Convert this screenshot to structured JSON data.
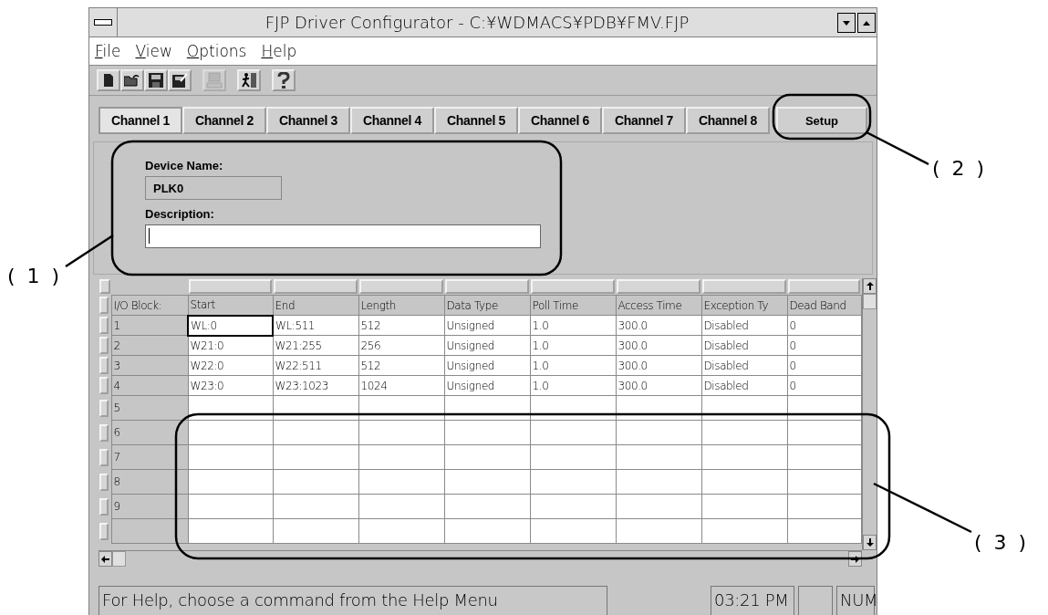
{
  "window": {
    "title": "FJP Driver Configurator - C:¥WDMACS¥PDB¥FMV.FJP"
  },
  "menu": [
    "File",
    "View",
    "Options",
    "Help"
  ],
  "toolbar": [
    {
      "kind": "new",
      "disabled": false
    },
    {
      "kind": "open",
      "disabled": false
    },
    {
      "kind": "save",
      "disabled": false
    },
    {
      "kind": "save-as",
      "disabled": false
    },
    {
      "kind": "computer",
      "disabled": true
    },
    {
      "kind": "exit",
      "disabled": false
    },
    {
      "kind": "help",
      "disabled": false
    }
  ],
  "tabs": [
    {
      "label": "Channel 1",
      "selected": true
    },
    {
      "label": "Channel 2",
      "selected": false
    },
    {
      "label": "Channel 3",
      "selected": false
    },
    {
      "label": "Channel 4",
      "selected": false
    },
    {
      "label": "Channel 5",
      "selected": false
    },
    {
      "label": "Channel 6",
      "selected": false
    },
    {
      "label": "Channel 7",
      "selected": false
    },
    {
      "label": "Channel 8",
      "selected": false
    }
  ],
  "setup_button": {
    "label": "Setup"
  },
  "device": {
    "name_label": "Device Name:",
    "name": "PLK0",
    "description_label": "Description:"
  },
  "grid": {
    "columns": [
      "I/O Block:",
      "Start",
      "End",
      "Length",
      "Data Type",
      "Poll Time",
      "Access Time",
      "Exception Ty",
      "Dead Band"
    ],
    "rows": [
      {
        "cells": [
          "1",
          "WL:0",
          "WL:511",
          "512",
          "Unsigned",
          "1.0",
          "300.0",
          "Disabled",
          "0"
        ],
        "focused": true
      },
      {
        "cells": [
          "2",
          "W21:0",
          "W21:255",
          "256",
          "Unsigned",
          "1.0",
          "300.0",
          "Disabled",
          "0"
        ],
        "focused": false
      },
      {
        "cells": [
          "3",
          "W22:0",
          "W22:511",
          "512",
          "Unsigned",
          "1.0",
          "300.0",
          "Disabled",
          "0"
        ],
        "focused": false
      },
      {
        "cells": [
          "4",
          "W23:0",
          "W23:1023",
          "1024",
          "Unsigned",
          "1.0",
          "300.0",
          "Disabled",
          "0"
        ],
        "focused": false
      },
      {
        "cells": [
          "5"
        ],
        "focused": false
      },
      {
        "cells": [
          "6"
        ],
        "focused": false
      },
      {
        "cells": [
          "7"
        ],
        "focused": false
      },
      {
        "cells": [
          "8"
        ],
        "focused": false
      },
      {
        "cells": [
          "9"
        ],
        "focused": false
      }
    ]
  },
  "status_bar": {
    "message": "For Help, choose a command from the Help Menu",
    "time": "03:21 PM",
    "indicator": "NUM"
  },
  "annotations": [
    "( 1 )",
    "( 2 )",
    "( 3 )"
  ]
}
